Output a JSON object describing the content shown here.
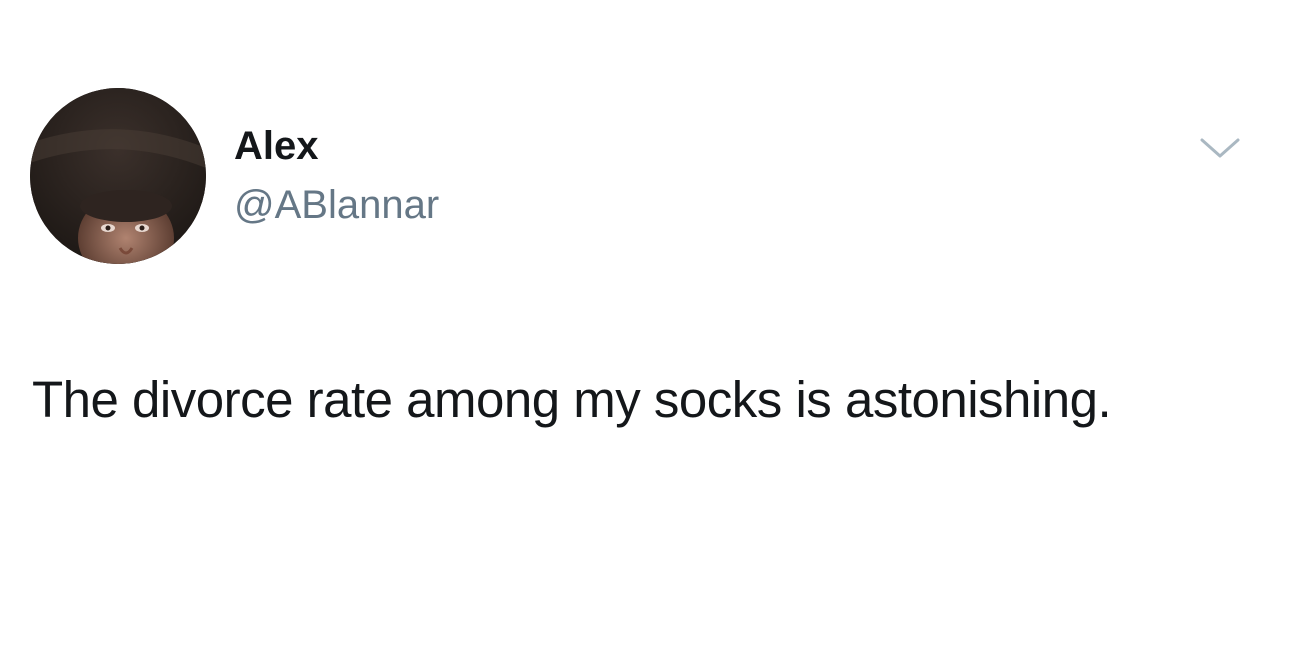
{
  "tweet": {
    "author": {
      "display_name": "Alex",
      "handle": "@ABlannar",
      "avatar_icon": "profile-photo"
    },
    "text": "The divorce rate among my socks is astonishing.",
    "menu_icon": "chevron-down-icon"
  },
  "colors": {
    "background": "#ffffff",
    "text_primary": "#14171a",
    "text_secondary": "#657786",
    "caret": "#aab8c2"
  }
}
